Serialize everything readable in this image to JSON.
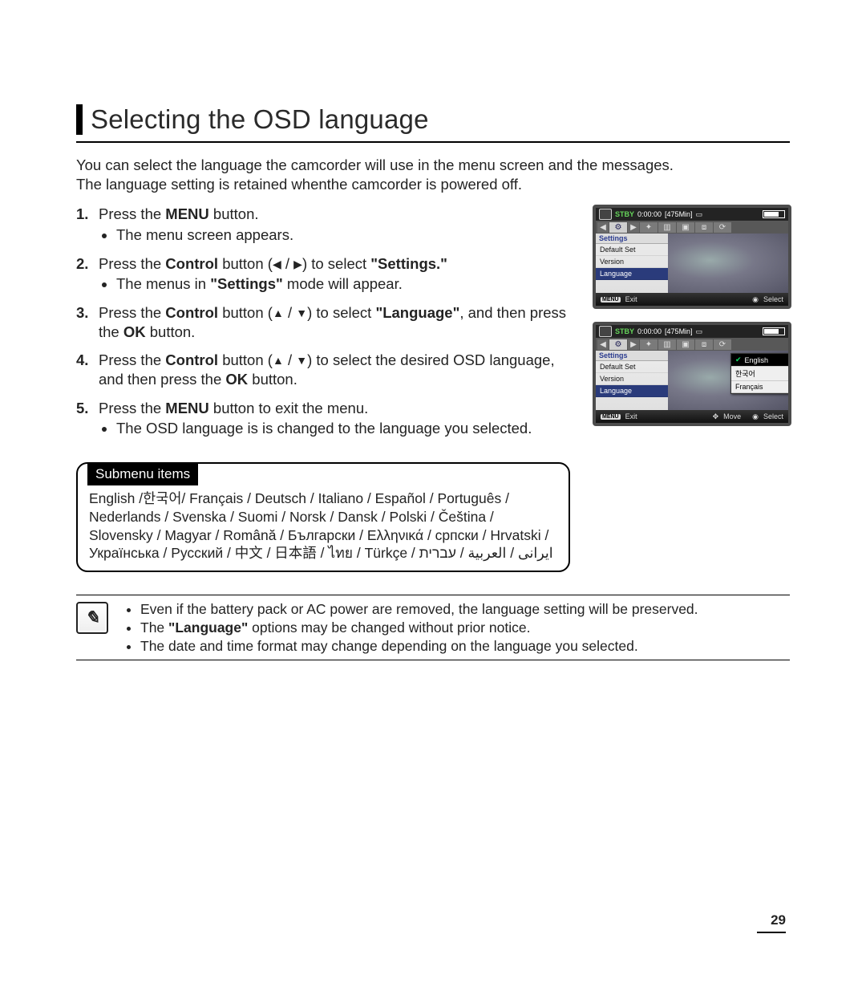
{
  "heading": "Selecting the OSD language",
  "intro_line1": "You can select the language the camcorder will use in the menu screen and the messages.",
  "intro_line2": "The language setting is retained whenthe camcorder is powered off.",
  "steps": {
    "s1_a": "Press the ",
    "s1_b": "MENU",
    "s1_c": " button.",
    "s1_sub": "The menu screen appears.",
    "s2_a": "Press the ",
    "s2_b": "Control",
    "s2_c": " button (",
    "s2_d": ") to select ",
    "s2_e": "\"Settings.\"",
    "s2_sub_a": "The menus in ",
    "s2_sub_b": "\"Settings\"",
    "s2_sub_c": " mode will appear.",
    "s3_a": "Press the ",
    "s3_b": "Control",
    "s3_c": " button (",
    "s3_d": ") to select ",
    "s3_e": "\"Language\"",
    "s3_f": ", and then press the ",
    "s3_g": "OK",
    "s3_h": " button.",
    "s4_a": "Press the ",
    "s4_b": "Control",
    "s4_c": " button (",
    "s4_d": ") to select the desired OSD language, and then press the ",
    "s4_e": "OK",
    "s4_f": " button.",
    "s5_a": "Press the ",
    "s5_b": "MENU",
    "s5_c": " button to exit the menu.",
    "s5_sub": "The OSD language is is changed to the language you selected."
  },
  "submenu": {
    "label": "Submenu items",
    "body": "English /한국어/ Français / Deutsch / Italiano / Español / Português / Nederlands / Svenska / Suomi / Norsk / Dansk / Polski / Čeština / Slovensky / Magyar / Română / Български / Ελληνικά / српски / Hrvatski / Українська / Русский / 中文 / 日本語 / ไทย / Türkçe / ايرانى / العربية / עברית"
  },
  "notes": {
    "n1": "Even if the battery pack or AC power are removed, the language setting will be preserved.",
    "n2_a": "The ",
    "n2_b": "\"Language\"",
    "n2_c": " options may be changed without prior notice.",
    "n3": "The date and time format may change depending on the language you selected."
  },
  "page_number": "29",
  "lcd": {
    "stby": "STBY",
    "time": "0:00:00",
    "remain": "[475Min]",
    "settings_title": "Settings",
    "item_default": "Default Set",
    "item_version": "Version",
    "item_language": "Language",
    "btn_menu": "MENU",
    "exit": "Exit",
    "select": "Select",
    "move": "Move",
    "lang_en": "English",
    "lang_ko": "한국어",
    "lang_fr": "Français"
  }
}
